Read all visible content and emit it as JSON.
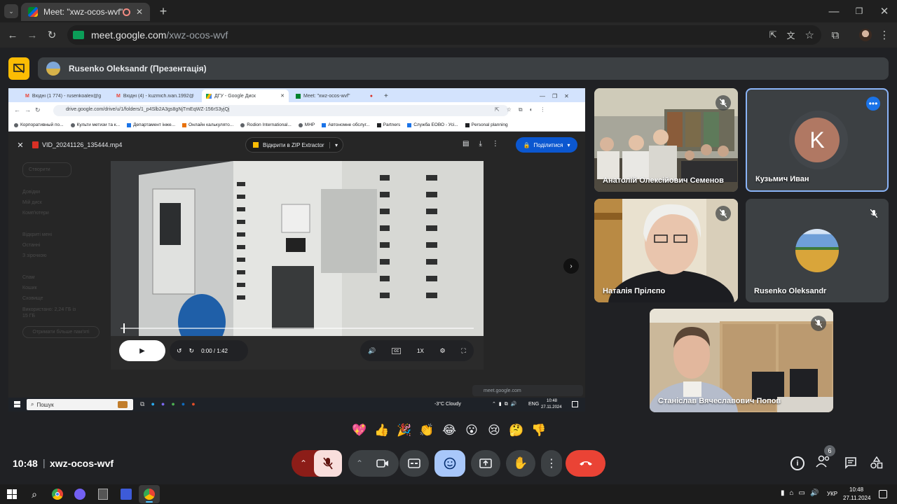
{
  "browser": {
    "tab_title": "Meet: \"xwz-ocos-wvf\"",
    "new_tab": "+",
    "url_domain": "meet.google.com",
    "url_path": "/xwz-ocos-wvf"
  },
  "presenter": {
    "name": "Rusenko Oleksandr (Презентація)"
  },
  "shared": {
    "tabs": [
      "Вхідні (1 774) - rusenkoalex@g",
      "Вхідні (4) - kuzmich.ivan.1992@",
      "ДГУ - Google Диск",
      "Meet: \"xwz-ocos-wvf\""
    ],
    "url": "drive.google.com/drive/u/1/folders/1_p4Slb2A3gs8gNjTmEqWZ-156rS3yjQj",
    "bookmarks": [
      "Корпоративный по...",
      "Культи метизи та к...",
      "Департамент інже...",
      "Онлайн калькулято...",
      "Rodion International...",
      "МНР",
      "Автономне обслуг...",
      "Partners",
      "Служба ЕОВО - Усі...",
      "Personal planning"
    ],
    "file_name": "VID_20241126_135444.mp4",
    "open_with": "Відкрити в ZIP Extractor",
    "share_btn": "Поділитися",
    "time": "0:00 / 1:42",
    "speed": "1X",
    "sidebar": [
      "Створити",
      "Довідки",
      "Мій диск",
      "Комп'ютери",
      "Відкриті мені",
      "Останні",
      "З зірочкою",
      "Спам",
      "Кошик",
      "Сховище",
      "Використано: 2,24 ГБ із 15 ГБ",
      "Отримати більше пам'яті"
    ],
    "meet_pill": "meet.google.com",
    "taskbar_search": "Пошук",
    "weather": "-3°C  Cloudy",
    "lang": "ENG",
    "clock_time": "10:48",
    "clock_date": "27.11.2024"
  },
  "participants": [
    {
      "name": "Анатолій Олексійович Семенов"
    },
    {
      "name": "Кузьмич Иван",
      "initial": "K"
    },
    {
      "name": "Наталія Прілєпо"
    },
    {
      "name": "Rusenko Oleksandr"
    },
    {
      "name": "Станіслав Вячеславович Попов"
    }
  ],
  "reactions": [
    "💖",
    "👍",
    "🎉",
    "👏",
    "😂",
    "😮",
    "😢",
    "🤔",
    "👎"
  ],
  "meeting": {
    "time": "10:48",
    "separator": "|",
    "code": "xwz-ocos-wvf",
    "people_count": "6"
  },
  "win_taskbar": {
    "lang": "УКР",
    "time": "10:48",
    "date": "27.11.2024"
  },
  "colors": {
    "accent_blue": "#1a73e8",
    "end_call_red": "#ea4335",
    "mic_off_bg": "#f9dedc",
    "presenter_yellow": "#fbbc04",
    "reaction_btn": "#a8c7fa"
  }
}
